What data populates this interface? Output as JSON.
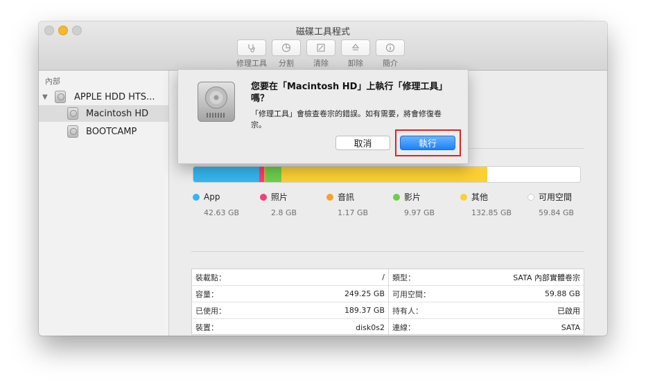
{
  "window": {
    "title": "磁碟工具程式"
  },
  "toolbar": {
    "items": [
      {
        "label": "修理工具",
        "icon": "stethoscope-icon"
      },
      {
        "label": "分割",
        "icon": "pie-icon"
      },
      {
        "label": "清除",
        "icon": "erase-icon"
      },
      {
        "label": "卸除",
        "icon": "eject-icon"
      },
      {
        "label": "簡介",
        "icon": "info-icon"
      }
    ]
  },
  "sidebar": {
    "header": "內部",
    "items": [
      {
        "label": "APPLE HDD HTS...",
        "level": 0
      },
      {
        "label": "Macintosh HD",
        "level": 1,
        "selected": true
      },
      {
        "label": "BOOTCAMP",
        "level": 1
      }
    ]
  },
  "dialog": {
    "title": "您要在「Macintosh HD」上執行「修理工具」嗎？",
    "message": "「修理工具」會檢查卷宗的錯誤。如有需要，將會修復卷宗。",
    "cancel_label": "取消",
    "run_label": "執行"
  },
  "usage": {
    "segments": [
      {
        "name": "App",
        "size": "42.63 GB",
        "gb": 42.63,
        "color": "#35b6f0"
      },
      {
        "name": "照片",
        "size": "2.8 GB",
        "gb": 2.8,
        "color": "#f0417a"
      },
      {
        "name": "音訊",
        "size": "1.17 GB",
        "gb": 1.17,
        "color": "#f8a02c"
      },
      {
        "name": "影片",
        "size": "9.97 GB",
        "gb": 9.97,
        "color": "#6ccf4a"
      },
      {
        "name": "其他",
        "size": "132.85 GB",
        "gb": 132.85,
        "color": "#fbd033"
      },
      {
        "name": "可用空間",
        "size": "59.84 GB",
        "gb": 59.84,
        "color": "#ffffff"
      }
    ]
  },
  "info": {
    "left": [
      {
        "key": "裝載點：",
        "value": "/"
      },
      {
        "key": "容量：",
        "value": "249.25 GB"
      },
      {
        "key": "已使用：",
        "value": "189.37 GB"
      },
      {
        "key": "裝置：",
        "value": "disk0s2"
      }
    ],
    "right": [
      {
        "key": "類型：",
        "value": "SATA 內部實體卷宗"
      },
      {
        "key": "可用空間：",
        "value": "59.88 GB"
      },
      {
        "key": "持有人：",
        "value": "已啟用"
      },
      {
        "key": "連線：",
        "value": "SATA"
      }
    ]
  }
}
